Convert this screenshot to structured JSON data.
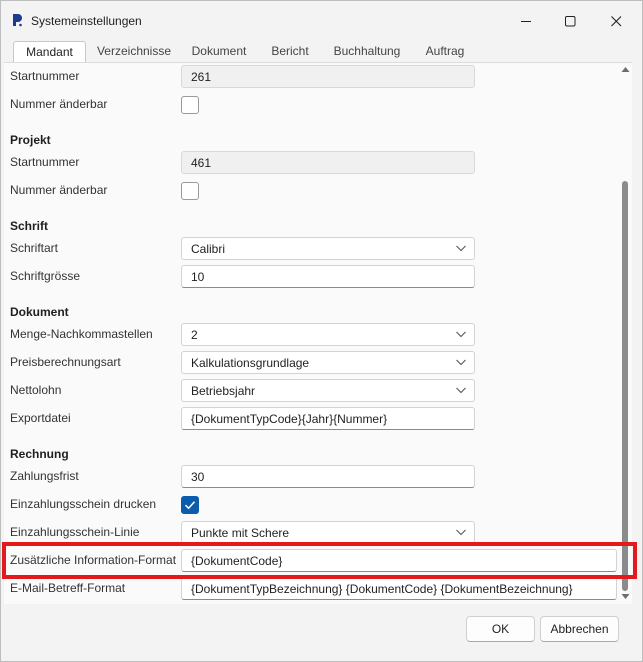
{
  "window": {
    "title": "Systemeinstellungen",
    "app_icon": "app-logo-icon",
    "controls": [
      "minimize-icon",
      "maximize-icon",
      "close-icon"
    ]
  },
  "tabs": [
    {
      "label": "Mandant",
      "active": true
    },
    {
      "label": "Verzeichnisse",
      "active": false
    },
    {
      "label": "Dokument",
      "active": false
    },
    {
      "label": "Bericht",
      "active": false
    },
    {
      "label": "Buchhaltung",
      "active": false
    },
    {
      "label": "Auftrag",
      "active": false
    }
  ],
  "top": {
    "startnummer_label": "Startnummer",
    "startnummer_value": "261",
    "aenderbar_label": "Nummer änderbar"
  },
  "projekt": {
    "heading": "Projekt",
    "startnummer_label": "Startnummer",
    "startnummer_value": "461",
    "aenderbar_label": "Nummer änderbar"
  },
  "schrift": {
    "heading": "Schrift",
    "schriftart_label": "Schriftart",
    "schriftart_value": "Calibri",
    "groesse_label": "Schriftgrösse",
    "groesse_value": "10"
  },
  "dokument": {
    "heading": "Dokument",
    "nachkomma_label": "Menge-Nachkommastellen",
    "nachkomma_value": "2",
    "preis_label": "Preisberechnungsart",
    "preis_value": "Kalkulationsgrundlage",
    "nettolohn_label": "Nettolohn",
    "nettolohn_value": "Betriebsjahr",
    "export_label": "Exportdatei",
    "export_value": "{DokumentTypCode}{Jahr}{Nummer}"
  },
  "rechnung": {
    "heading": "Rechnung",
    "frist_label": "Zahlungsfrist",
    "frist_value": "30",
    "einzahlung_label": "Einzahlungsschein drucken",
    "einzahlung_checked": true,
    "linie_label": "Einzahlungsschein-Linie",
    "linie_value": "Punkte mit Schere",
    "zusatz_label": "Zusätzliche Information-Format",
    "zusatz_value": "{DokumentCode}",
    "betreff_label": "E-Mail-Betreff-Format",
    "betreff_value": "{DokumentTypBezeichnung} {DokumentCode} {DokumentBezeichnung}"
  },
  "buttons": {
    "ok": "OK",
    "cancel": "Abbrechen"
  },
  "colors": {
    "highlight": "#e3191b",
    "checkbox_accent": "#0b5cad"
  }
}
